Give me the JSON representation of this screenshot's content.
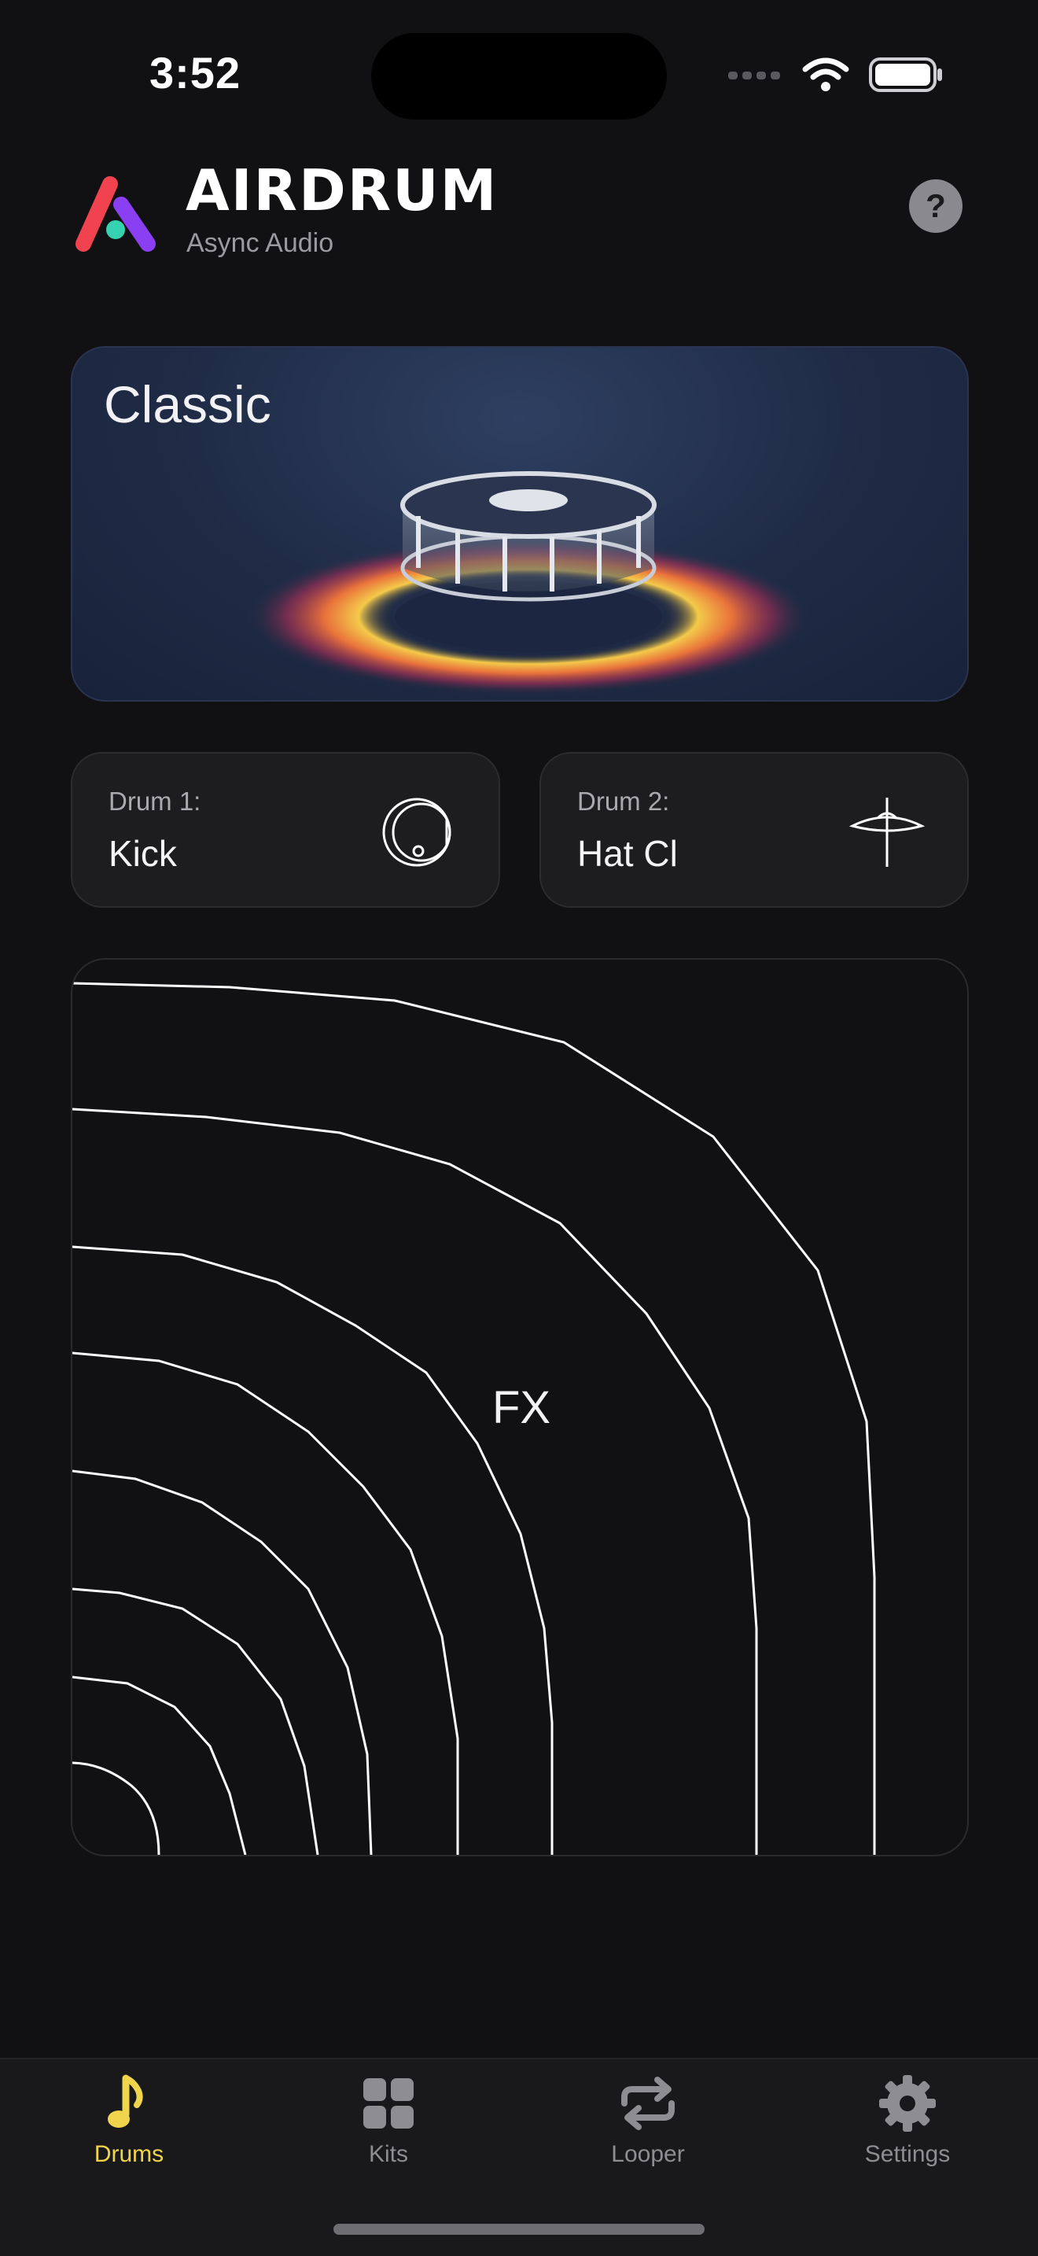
{
  "status_bar": {
    "time": "3:52"
  },
  "header": {
    "title": "AIRDRUM",
    "subtitle": "Async Audio",
    "help_label": "?"
  },
  "kit": {
    "name": "Classic"
  },
  "drums": [
    {
      "label": "Drum 1:",
      "value": "Kick",
      "icon": "kick-drum-icon"
    },
    {
      "label": "Drum 2:",
      "value": "Hat Cl",
      "icon": "hi-hat-icon"
    }
  ],
  "fx_pad": {
    "label": "FX"
  },
  "tabs": [
    {
      "label": "Drums",
      "icon": "music-note-icon",
      "active": true
    },
    {
      "label": "Kits",
      "icon": "grid-icon",
      "active": false
    },
    {
      "label": "Looper",
      "icon": "repeat-icon",
      "active": false
    },
    {
      "label": "Settings",
      "icon": "gear-icon",
      "active": false
    }
  ],
  "colors": {
    "background": "#111113",
    "accent": "#f0d54c",
    "logo_red": "#f0424f",
    "logo_purple": "#8a3ff2",
    "logo_teal": "#36d1b0"
  }
}
